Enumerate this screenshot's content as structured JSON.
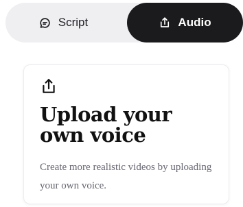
{
  "tabs": {
    "script": {
      "label": "Script",
      "icon": "chat-bubble-icon"
    },
    "audio": {
      "label": "Audio",
      "icon": "upload-icon",
      "selected": true
    }
  },
  "card": {
    "icon": "upload-icon",
    "title": "Upload your own voice",
    "description": "Create more realistic videos by uploading your own voice."
  },
  "colors": {
    "tabs_background": "#efeff2",
    "active_tab": "#1b1b1d",
    "title": "#111111",
    "description": "#666670"
  }
}
